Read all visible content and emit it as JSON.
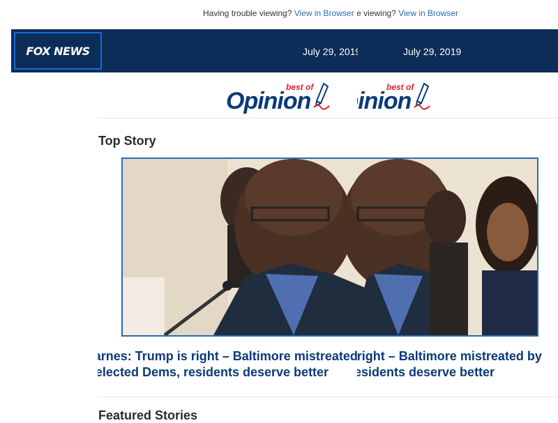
{
  "topbar": {
    "text": "Having trouble viewing?",
    "link": "View in Browser"
  },
  "header": {
    "logo": "FOX NEWS",
    "date": "July 29, 2019"
  },
  "opinion": {
    "word": "Opinion",
    "best_of": "best of"
  },
  "top_story": {
    "section_title": "Top Story",
    "headline_line1": "Todd Starnes: Trump is right – Baltimore mistreated by",
    "headline_line2": "elected Dems, residents deserve better"
  },
  "featured": {
    "section_title": "Featured Stories"
  },
  "colors": {
    "header_bg": "#0b2d57",
    "link": "#2a6bb3",
    "headline": "#0b3a78",
    "accent_red": "#d8242e"
  }
}
